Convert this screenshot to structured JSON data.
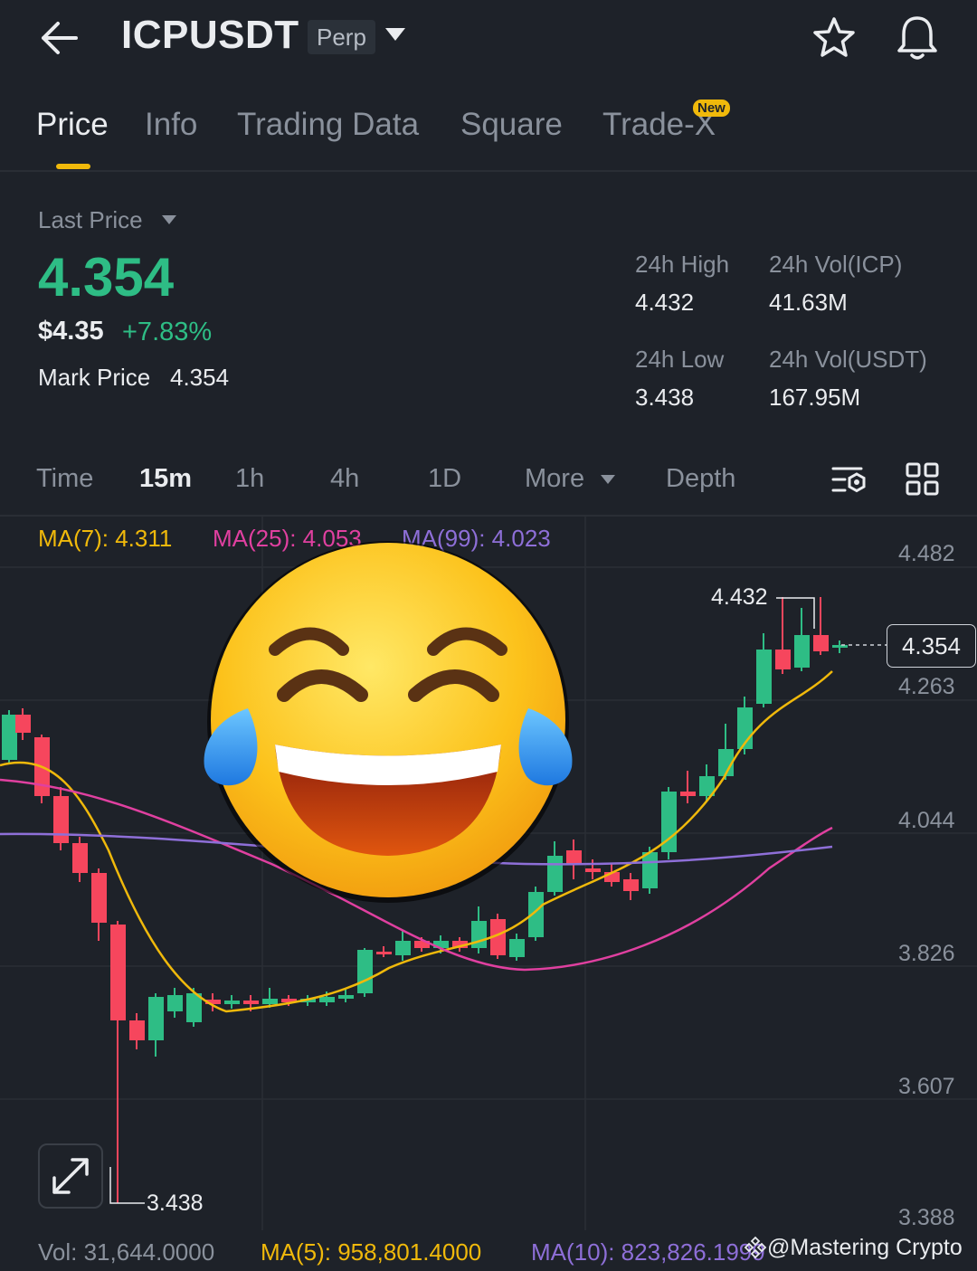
{
  "header": {
    "symbol": "ICPUSDT",
    "contract_type": "Perp"
  },
  "tabs": [
    {
      "label": "Price",
      "active": true
    },
    {
      "label": "Info"
    },
    {
      "label": "Trading Data"
    },
    {
      "label": "Square"
    },
    {
      "label": "Trade-X",
      "badge": "New"
    }
  ],
  "price": {
    "last_price_label": "Last Price",
    "last_price": "4.354",
    "usd_price": "$4.35",
    "change_pct": "+7.83%",
    "mark_price_label": "Mark Price",
    "mark_price": "4.354"
  },
  "stats": {
    "high_label": "24h High",
    "high": "4.432",
    "low_label": "24h Low",
    "low": "3.438",
    "vol_icp_label": "24h Vol(ICP)",
    "vol_icp": "41.63M",
    "vol_usdt_label": "24h Vol(USDT)",
    "vol_usdt": "167.95M"
  },
  "intervals": {
    "time": "Time",
    "m15": "15m",
    "h1": "1h",
    "h4": "4h",
    "d1": "1D",
    "more": "More",
    "depth": "Depth",
    "active": "15m"
  },
  "chart": {
    "ma7": "MA(7): 4.311",
    "ma25": "MA(25): 4.053",
    "ma99": "MA(99): 4.023",
    "axis": [
      "4.482",
      "4.263",
      "4.044",
      "3.826",
      "3.607",
      "3.388"
    ],
    "current_price": "4.354",
    "high_mark": "4.432",
    "low_mark": "3.438",
    "vol": "Vol: 31,644.0000",
    "vol_ma5": "MA(5): 958,801.4000",
    "vol_ma10": "MA(10): 823,826.1999",
    "watermark": "@Mastering Crypto"
  },
  "colors": {
    "up": "#2ebd85",
    "down": "#f6465d",
    "ma7": "#f0b90b",
    "ma25": "#e040a0",
    "ma99": "#8e6fd8",
    "accent": "#f0b90b"
  },
  "icons": [
    "back-arrow-icon",
    "caret-down-icon",
    "star-icon",
    "bell-icon",
    "chart-settings-icon",
    "grid-layout-icon",
    "expand-icon",
    "laughing-emoji"
  ]
}
